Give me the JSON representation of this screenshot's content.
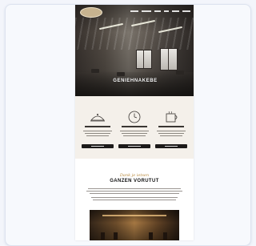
{
  "hero": {
    "title": "GENIEHNAKEBE"
  },
  "nav": {
    "items": [
      "",
      "",
      "",
      "",
      "",
      ""
    ]
  },
  "about": {
    "script_title": "Dank je ietsen",
    "title": "GANZEN VORUTUT"
  },
  "colors": {
    "features_bg": "#f4f0ea",
    "button_dark": "#1c1a19",
    "accent_gold": "#b8893c",
    "panel_bg": "#f7f9fd"
  },
  "features": [
    {
      "icon": "dish-icon"
    },
    {
      "icon": "clock-icon"
    },
    {
      "icon": "coffee-cup-icon"
    }
  ]
}
